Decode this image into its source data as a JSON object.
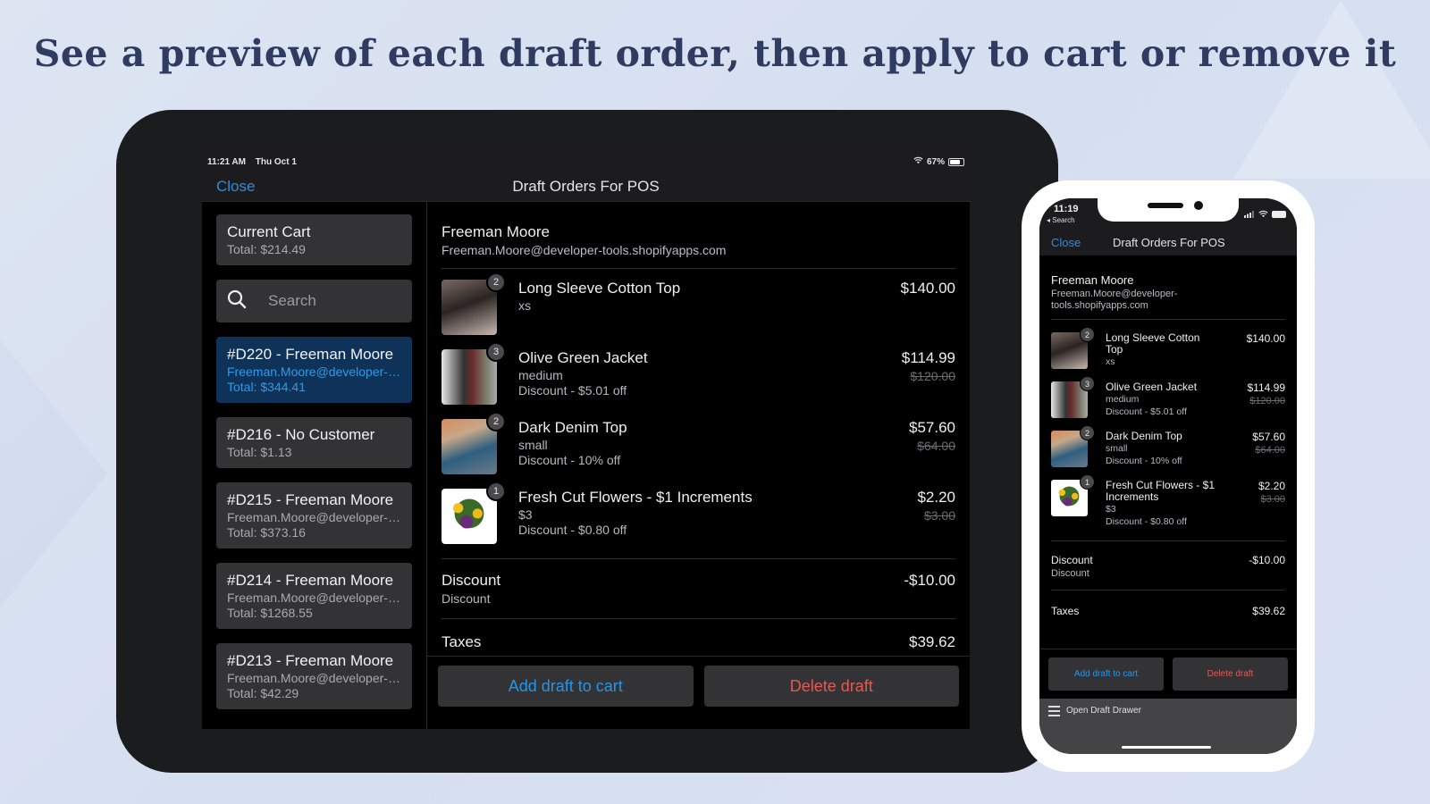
{
  "headline": "See a preview of each draft order, then apply to cart or remove it",
  "colors": {
    "accent_blue": "#2596e6",
    "danger_red": "#e25a55",
    "selected_bg": "#0f3259",
    "headline": "#2f3b61"
  },
  "ipad": {
    "status": {
      "time": "11:21 AM",
      "date": "Thu Oct 1",
      "battery": "67%",
      "battery_level": 0.67
    },
    "nav": {
      "close_label": "Close",
      "title": "Draft Orders For POS"
    },
    "sidebar": {
      "current_cart": {
        "title": "Current Cart",
        "total": "Total: $214.49"
      },
      "search_placeholder": "Search",
      "drafts": [
        {
          "title": "#D220 - Freeman Moore",
          "email": "Freeman.Moore@developer-t...",
          "total": "Total: $344.41",
          "selected": true
        },
        {
          "title": "#D216 - No Customer",
          "total": "Total: $1.13"
        },
        {
          "title": "#D215 - Freeman Moore",
          "email": "Freeman.Moore@developer-t...",
          "total": "Total: $373.16"
        },
        {
          "title": "#D214 - Freeman Moore",
          "email": "Freeman.Moore@developer-t...",
          "total": "Total: $1268.55"
        },
        {
          "title": "#D213 - Freeman Moore",
          "email": "Freeman.Moore@developer-t...",
          "total": "Total: $42.29"
        }
      ]
    },
    "detail": {
      "customer_name": "Freeman Moore",
      "customer_email": "Freeman.Moore@developer-tools.shopifyapps.com",
      "line_items": [
        {
          "name": "Long Sleeve Cotton Top",
          "variant": "xs",
          "qty": "2",
          "price": "$140.00"
        },
        {
          "name": "Olive Green Jacket",
          "variant": "medium",
          "discount": "Discount - $5.01 off",
          "qty": "3",
          "price": "$114.99",
          "original": "$120.00"
        },
        {
          "name": "Dark Denim Top",
          "variant": "small",
          "discount": "Discount - 10% off",
          "qty": "2",
          "price": "$57.60",
          "original": "$64.00"
        },
        {
          "name": "Fresh Cut Flowers - $1 Increments",
          "variant": "$3",
          "discount": "Discount - $0.80 off",
          "qty": "1",
          "price": "$2.20",
          "original": "$3.00"
        }
      ],
      "discount": {
        "label": "Discount",
        "sub": "Discount",
        "value": "-$10.00"
      },
      "taxes": {
        "label": "Taxes",
        "value": "$39.62"
      }
    },
    "actions": {
      "add_label": "Add draft to cart",
      "delete_label": "Delete draft"
    }
  },
  "phone": {
    "status": {
      "time": "11:19",
      "back_label": "◂ Search"
    },
    "nav": {
      "close_label": "Close",
      "title": "Draft Orders For POS"
    },
    "customer_name": "Freeman Moore",
    "customer_email": "Freeman.Moore@developer-tools.shopifyapps.com",
    "line_items": [
      {
        "name": "Long Sleeve Cotton Top",
        "variant": "xs",
        "qty": "2",
        "price": "$140.00"
      },
      {
        "name": "Olive Green Jacket",
        "variant": "medium",
        "discount": "Discount - $5.01 off",
        "qty": "3",
        "price": "$114.99",
        "original": "$120.00"
      },
      {
        "name": "Dark Denim Top",
        "variant": "small",
        "discount": "Discount - 10% off",
        "qty": "2",
        "price": "$57.60",
        "original": "$64.00"
      },
      {
        "name": "Fresh Cut Flowers - $1 Increments",
        "variant": "$3",
        "discount": "Discount - $0.80 off",
        "qty": "1",
        "price": "$2.20",
        "original": "$3.00"
      }
    ],
    "discount": {
      "label": "Discount",
      "sub": "Discount",
      "value": "-$10.00"
    },
    "taxes": {
      "label": "Taxes",
      "value": "$39.62"
    },
    "actions": {
      "add_label": "Add draft to cart",
      "delete_label": "Delete draft"
    },
    "drawer_label": "Open Draft Drawer"
  }
}
